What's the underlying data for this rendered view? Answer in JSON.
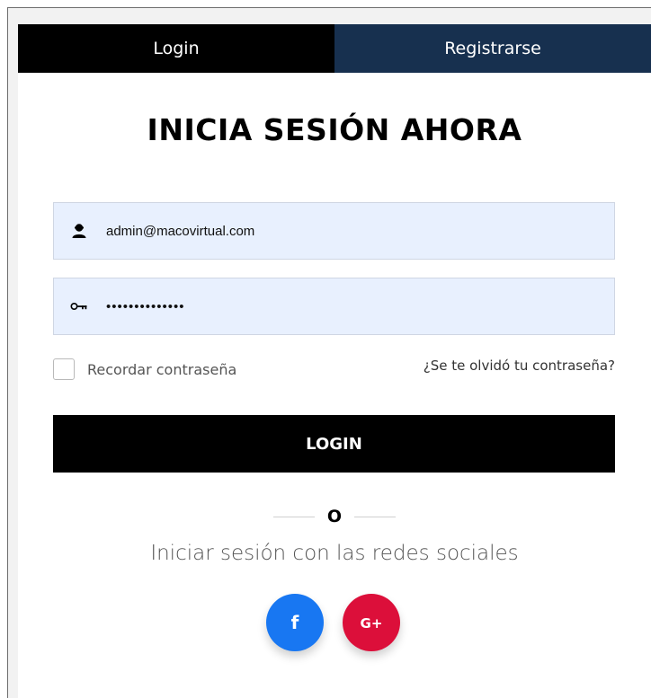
{
  "tabs": [
    {
      "label": "Login",
      "active": true
    },
    {
      "label": "Registrarse",
      "active": false
    }
  ],
  "title": "INICIA SESIÓN AHORA",
  "form": {
    "email_value": "admin@macovirtual.com",
    "password_value": "••••••••••••••",
    "remember_label": "Recordar contraseña",
    "remember_checked": false,
    "forgot_label": "¿Se te olvidó tu contraseña?",
    "login_label": "LOGIN"
  },
  "divider_text": "O",
  "social": {
    "text": "Iniciar sesión con las redes sociales",
    "facebook_label": "f",
    "google_label": "G+"
  },
  "colors": {
    "tab_active": "#000000",
    "tab_inactive": "#17304f",
    "input_bg": "#e8f0fe",
    "facebook": "#1877f2",
    "google": "#dc0f3a"
  },
  "icons": {
    "email": "user-icon",
    "password": "key-icon"
  }
}
